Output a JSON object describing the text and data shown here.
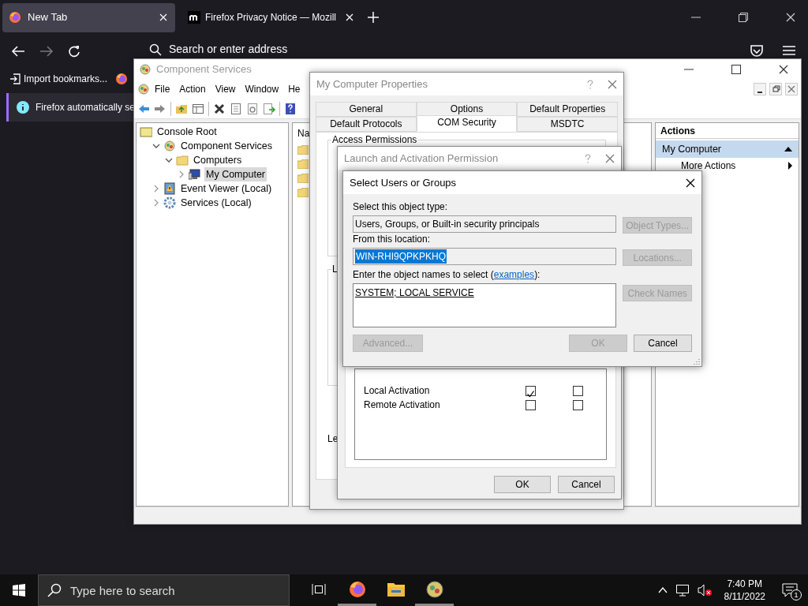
{
  "browser": {
    "tabs": [
      {
        "title": "New Tab",
        "selected": true,
        "kind": "firefox"
      },
      {
        "title": "Firefox Privacy Notice — Mozill",
        "selected": false,
        "kind": "mozilla"
      }
    ],
    "address": {
      "placeholder": "Search or enter address"
    },
    "import_bookmarks": "Import bookmarks...",
    "notification": "Firefox automatically se"
  },
  "mmc": {
    "title": "Component Services",
    "menu": [
      "File",
      "Action",
      "View",
      "Window",
      "He"
    ],
    "tree": [
      {
        "label": "Console Root",
        "kind": "root",
        "selected": false,
        "children": [
          {
            "label": "Component Services",
            "kind": "component",
            "expanded": true,
            "selected": false,
            "children": [
              {
                "label": "Computers",
                "kind": "folder",
                "expanded": true,
                "selected": false,
                "children": [
                  {
                    "label": "My Computer",
                    "kind": "computer",
                    "expanded": false,
                    "selected": true
                  }
                ]
              }
            ]
          },
          {
            "label": "Event Viewer (Local)",
            "kind": "event",
            "expanded": false,
            "selected": false
          },
          {
            "label": "Services (Local)",
            "kind": "service",
            "expanded": false,
            "selected": false
          }
        ]
      }
    ],
    "list_header": "Na",
    "actions": {
      "title": "Actions",
      "items": [
        {
          "label": "My Computer",
          "kind": "section"
        },
        {
          "label": "More Actions",
          "kind": "submenu"
        }
      ]
    }
  },
  "properties": {
    "title": "My Computer Properties",
    "tab_rows": [
      [
        {
          "label": "General",
          "selected": false
        },
        {
          "label": "Options",
          "selected": false
        },
        {
          "label": "Default Properties",
          "selected": false
        }
      ],
      [
        {
          "label": "Default Protocols",
          "selected": false
        },
        {
          "label": "COM Security",
          "selected": true
        },
        {
          "label": "MSDTC",
          "selected": false
        }
      ]
    ],
    "groups": [
      "Access Permissions",
      "L"
    ],
    "footer_text": "Le"
  },
  "launch": {
    "title": "Launch and Activation Permission",
    "permissions": [
      {
        "name": "Local Activation",
        "allow": true,
        "deny": false
      },
      {
        "name": "Remote Activation",
        "allow": false,
        "deny": false
      }
    ],
    "buttons": [
      "OK",
      "Cancel"
    ]
  },
  "select": {
    "title": "Select Users or Groups",
    "fields": [
      {
        "label": "Select this object type:",
        "value": "Users, Groups, or Built-in security principals",
        "highlighted": false,
        "button": {
          "label": "Object Types...",
          "disabled": true
        }
      },
      {
        "label": "From this location:",
        "value": "WIN-RHI9QPKPKHQ",
        "highlighted": true,
        "button": {
          "label": "Locations...",
          "disabled": true
        }
      }
    ],
    "names_label_before": "Enter the object names to select (",
    "names_link": "examples",
    "names_label_after": "):",
    "names": "SYSTEM; LOCAL SERVICE",
    "check_button": {
      "label": "Check Names",
      "disabled": true
    },
    "buttons": [
      {
        "label": "Advanced...",
        "disabled": true
      },
      {
        "label": "OK",
        "disabled": true
      },
      {
        "label": "Cancel",
        "disabled": false
      }
    ]
  },
  "taskbar": {
    "search_placeholder": "Type here to search",
    "apps": [
      {
        "kind": "firefox",
        "running": true
      },
      {
        "kind": "explorer",
        "running": false
      },
      {
        "kind": "component",
        "running": true
      }
    ],
    "time": "7:40 PM",
    "date": "8/11/2022",
    "notifications": "1"
  }
}
